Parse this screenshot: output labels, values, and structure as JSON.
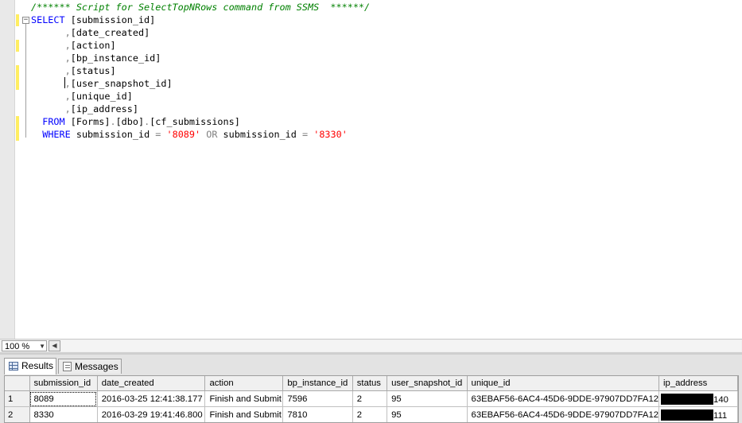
{
  "editor": {
    "lines": [
      {
        "parts": [
          {
            "t": "/****** Script for SelectTopNRows command from SSMS  ******/",
            "c": "cm"
          }
        ]
      },
      {
        "parts": [
          {
            "t": "SELECT",
            "c": "kw"
          },
          {
            "t": " [submission_id]"
          }
        ]
      },
      {
        "parts": [
          {
            "t": "      "
          },
          {
            "t": ",",
            "c": "op"
          },
          {
            "t": "[date_created]"
          }
        ]
      },
      {
        "parts": [
          {
            "t": "      "
          },
          {
            "t": ",",
            "c": "op"
          },
          {
            "t": "[action]"
          }
        ]
      },
      {
        "parts": [
          {
            "t": "      "
          },
          {
            "t": ",",
            "c": "op"
          },
          {
            "t": "[bp_instance_id]"
          }
        ]
      },
      {
        "parts": [
          {
            "t": "      "
          },
          {
            "t": ",",
            "c": "op"
          },
          {
            "t": "[status]"
          }
        ]
      },
      {
        "parts": [
          {
            "t": "      "
          },
          {
            "t": ",",
            "c": "op",
            "caret": true
          },
          {
            "t": "[user_snapshot_id]"
          }
        ]
      },
      {
        "parts": [
          {
            "t": "      "
          },
          {
            "t": ",",
            "c": "op"
          },
          {
            "t": "[unique_id]"
          }
        ]
      },
      {
        "parts": [
          {
            "t": "      "
          },
          {
            "t": ",",
            "c": "op"
          },
          {
            "t": "[ip_address]"
          }
        ]
      },
      {
        "parts": [
          {
            "t": "  "
          },
          {
            "t": "FROM",
            "c": "kw"
          },
          {
            "t": " [Forms]"
          },
          {
            "t": ".",
            "c": "op"
          },
          {
            "t": "[dbo]"
          },
          {
            "t": ".",
            "c": "op"
          },
          {
            "t": "[cf_submissions]"
          }
        ]
      },
      {
        "parts": [
          {
            "t": "  "
          },
          {
            "t": "WHERE",
            "c": "kw"
          },
          {
            "t": " submission_id "
          },
          {
            "t": "=",
            "c": "op"
          },
          {
            "t": " "
          },
          {
            "t": "'8089'",
            "c": "st"
          },
          {
            "t": " "
          },
          {
            "t": "OR",
            "c": "op"
          },
          {
            "t": " submission_id "
          },
          {
            "t": "=",
            "c": "op"
          },
          {
            "t": " "
          },
          {
            "t": "'8330'",
            "c": "st"
          }
        ]
      }
    ]
  },
  "zoom": {
    "value": "100 %"
  },
  "tabs": {
    "results": "Results",
    "messages": "Messages"
  },
  "grid": {
    "columns": [
      "submission_id",
      "date_created",
      "action",
      "bp_instance_id",
      "status",
      "user_snapshot_id",
      "unique_id",
      "ip_address"
    ],
    "rows": [
      {
        "num": "1",
        "cells": [
          "8089",
          "2016-03-25 12:41:38.177",
          "Finish and Submit",
          "7596",
          "2",
          "95",
          "63EBAF56-6AC4-45D6-9DDE-97907DD7FA12",
          "140"
        ]
      },
      {
        "num": "2",
        "cells": [
          "8330",
          "2016-03-29 19:41:46.800",
          "Finish and Submit",
          "7810",
          "2",
          "95",
          "63EBAF56-6AC4-45D6-9DDE-97907DD7FA12",
          "111"
        ]
      }
    ]
  },
  "colors": {
    "keyword": "#0000ff",
    "comment": "#008000",
    "string": "#ff0000",
    "operator": "#808080",
    "change_marker": "#ffee62"
  }
}
